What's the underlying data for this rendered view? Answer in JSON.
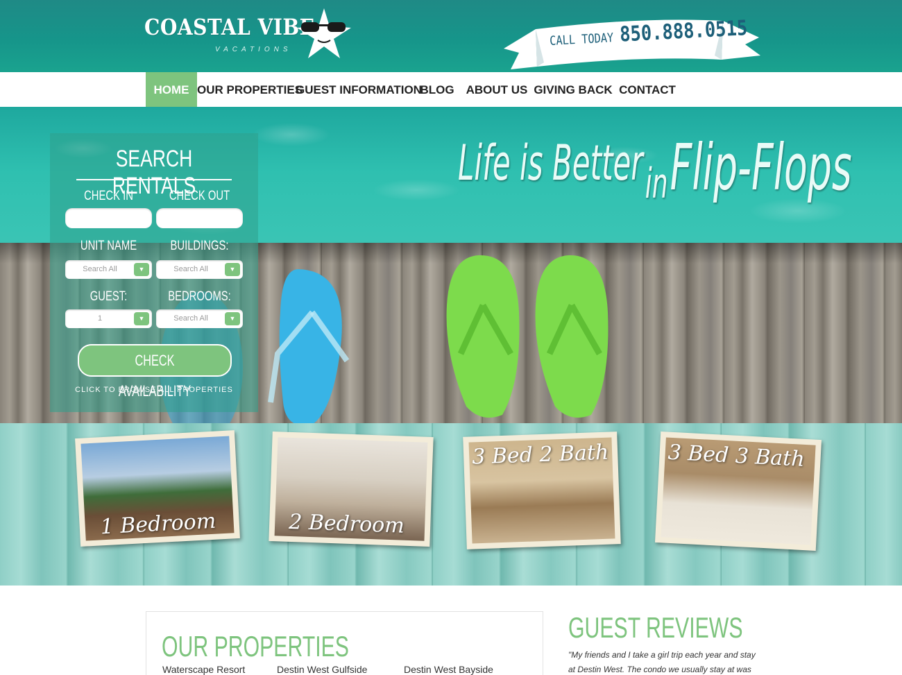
{
  "header": {
    "logo_main": "COASTAL VIBE",
    "logo_sub": "VACATIONS",
    "call_label": "CALL TODAY",
    "phone": "850.888.0515"
  },
  "nav": {
    "items": [
      {
        "label": "HOME",
        "active": true
      },
      {
        "label": "OUR PROPERTIES"
      },
      {
        "label": "GUEST INFORMATION"
      },
      {
        "label": "BLOG"
      },
      {
        "label": "ABOUT US"
      },
      {
        "label": "GIVING BACK"
      },
      {
        "label": "CONTACT"
      }
    ]
  },
  "hero": {
    "tagline_1": "Life is Better",
    "tagline_2": "in",
    "tagline_3": "Flip-Flops"
  },
  "search": {
    "title": "SEARCH RENTALS",
    "check_in_label": "CHECK IN",
    "check_out_label": "CHECK OUT",
    "unit_name_label": "UNIT NAME",
    "buildings_label": "BUILDINGS:",
    "guest_label": "GUEST:",
    "bedrooms_label": "BEDROOMS:",
    "unit_name_value": "Search All",
    "buildings_value": "Search All",
    "guest_value": "1",
    "bedrooms_value": "Search All",
    "button": "CHECK AVAILABILITY",
    "browse": "CLICK TO BROWSE ALL PROPERTIES"
  },
  "photos": [
    {
      "caption": "1 Bedroom"
    },
    {
      "caption": "2 Bedroom"
    },
    {
      "caption": "3 Bed 2 Bath"
    },
    {
      "caption": "3 Bed 3 Bath"
    }
  ],
  "properties": {
    "title": "OUR PROPERTIES",
    "links": [
      "Waterscape Resort",
      "Destin West Gulfside",
      "Destin West Bayside"
    ]
  },
  "reviews": {
    "title": "GUEST REVIEWS",
    "text": "\"My friends and I take a girl trip each year and stay at Destin West. The condo we usually stay at was"
  },
  "colors": {
    "header_teal": "#1a9a8c",
    "accent_green": "#7ec47e",
    "banner_text": "#1d5f79"
  }
}
